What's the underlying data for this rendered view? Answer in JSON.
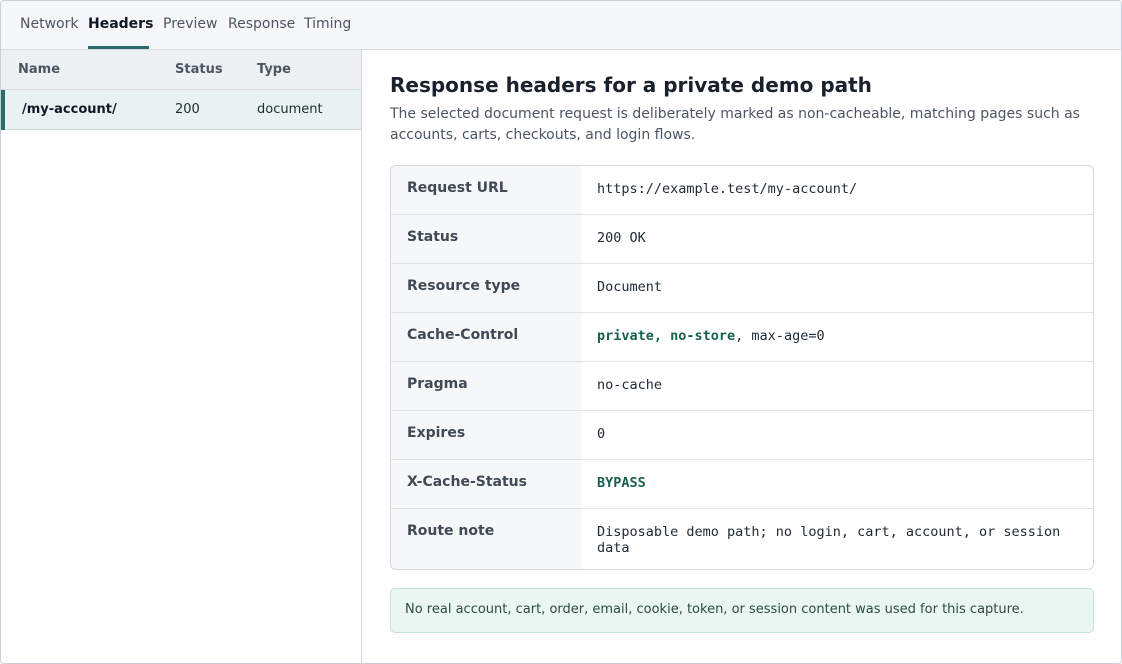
{
  "tabs": [
    {
      "label": "Network"
    },
    {
      "label": "Headers"
    },
    {
      "label": "Preview"
    },
    {
      "label": "Response"
    },
    {
      "label": "Timing"
    }
  ],
  "active_tab": "Headers",
  "request_list": {
    "columns": {
      "name": "Name",
      "status": "Status",
      "type": "Type"
    },
    "rows": [
      {
        "name": "/my-account/",
        "status": "200",
        "type": "document",
        "selected": true
      }
    ]
  },
  "detail": {
    "title": "Response headers for a private demo path",
    "description": "The selected document request is deliberately marked as non-cacheable, matching pages such as accounts, carts, checkouts, and login flows.",
    "headers": [
      {
        "key": "Request URL",
        "value": "https://example.test/my-account/"
      },
      {
        "key": "Status",
        "value": "200 OK"
      },
      {
        "key": "Resource type",
        "value": "Document"
      },
      {
        "key": "Cache-Control",
        "value_em": "private, no-store",
        "value_rest": ", max-age=0"
      },
      {
        "key": "Pragma",
        "value": "no-cache"
      },
      {
        "key": "Expires",
        "value": "0"
      },
      {
        "key": "X-Cache-Status",
        "value_em": "BYPASS"
      },
      {
        "key": "Route note",
        "value": "Disposable demo path; no login, cart, account, or session data"
      }
    ],
    "notice": "No real account, cart, order, email, cookie, token, or session content was used for this capture."
  },
  "colors": {
    "accent": "#2b6b6f",
    "highlight_value": "#17614f",
    "notice_bg": "#eaf6f1"
  }
}
